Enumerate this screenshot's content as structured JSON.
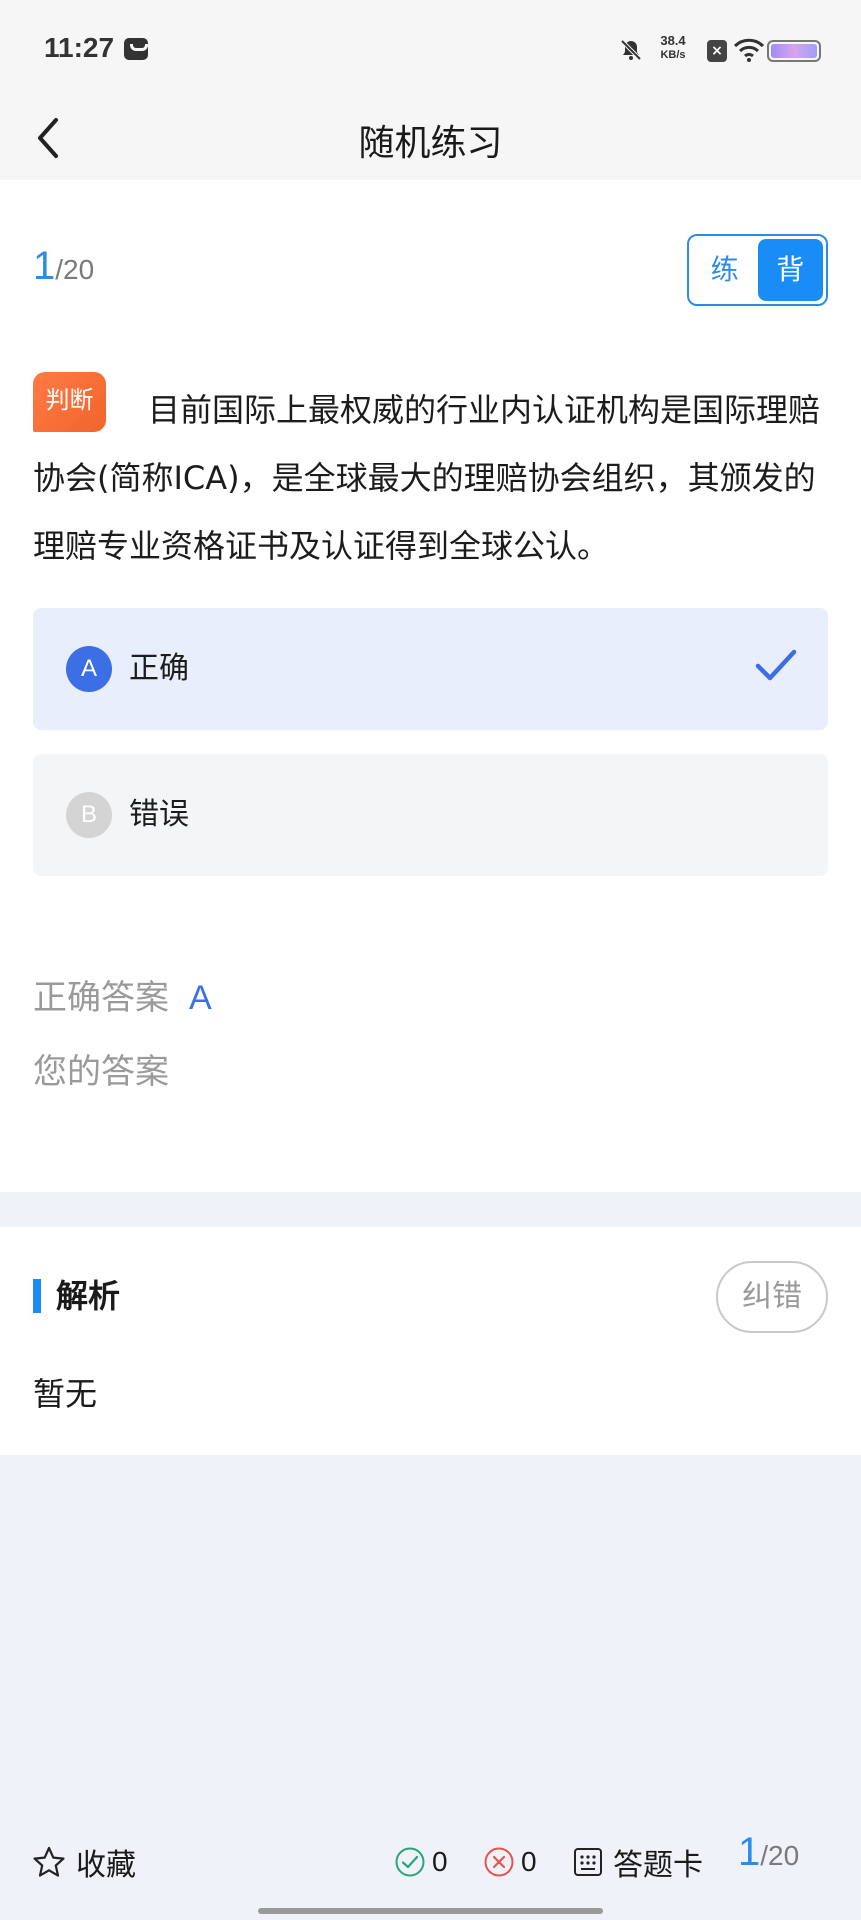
{
  "status_bar": {
    "time": "11:27",
    "net_speed_value": "38.4",
    "net_speed_unit": "KB/s",
    "sim_icon": "sim-x-icon"
  },
  "nav": {
    "title": "随机练习",
    "back_icon": "back-arrow-icon"
  },
  "progress": {
    "current": "1",
    "total": "/20"
  },
  "mode_toggle": {
    "practice": "练",
    "recite": "背",
    "active": "recite",
    "accent": "#1a8cf5"
  },
  "question": {
    "type_tag": "判断",
    "text": "目前国际上最权威的行业内认证机构是国际理赔协会(简称ICA)，是全球最大的理赔协会组织，其颁发的理赔专业资格证书及认证得到全球公认。"
  },
  "options": [
    {
      "letter": "A",
      "text": "正确",
      "state": "correct",
      "color": "#3c6ee6"
    },
    {
      "letter": "B",
      "text": "错误",
      "state": "normal",
      "color": "#d4d4d4"
    }
  ],
  "answers": {
    "correct_label": "正确答案",
    "correct_value": "A",
    "yours_label": "您的答案",
    "yours_value": ""
  },
  "analysis": {
    "title": "解析",
    "report_button": "纠错",
    "content": "暂无"
  },
  "bottom_bar": {
    "favorite_label": "收藏",
    "correct_count": "0",
    "wrong_count": "0",
    "answer_card_label": "答题卡",
    "current": "1",
    "total": "/20",
    "correct_color": "#2aa57a",
    "wrong_color": "#e5534b"
  }
}
